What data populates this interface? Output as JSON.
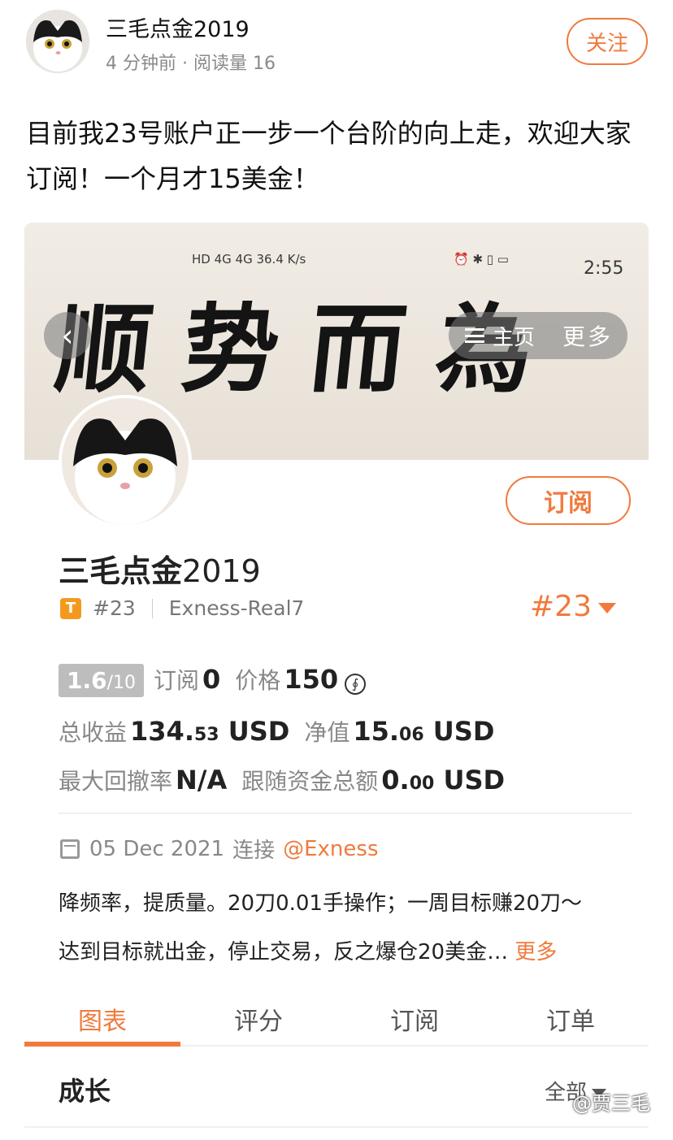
{
  "post": {
    "author": "三毛点金2019",
    "meta": "4 分钟前 · 阅读量 16",
    "follow_label": "关注",
    "text": "目前我23号账户正一步一个台阶的向上走，欢迎大家订阅！一个月才15美金！"
  },
  "screenshot": {
    "status_left": "HD 4G 4G 36.4 K/s",
    "status_time": "2:55",
    "banner_text": "顺势而為",
    "back_icon": "chevron-left-icon",
    "home_label": "主页",
    "more_label": "更多",
    "subscribe_label": "订阅",
    "profile": {
      "name_main": "三毛点金",
      "name_year": "2019",
      "tier_badge": "T",
      "rank": "#23",
      "broker": "Exness-Real7",
      "rank_right": "#23"
    },
    "stats": {
      "score": "1.6",
      "score_denom": "/10",
      "subs_label": "订阅",
      "subs_value": "0",
      "price_label": "价格",
      "price_value": "150",
      "coin_symbol": "∮",
      "total_label": "总收益",
      "total_int": "134.",
      "total_dec": "53",
      "total_unit": "USD",
      "equity_label": "净值",
      "equity_int": "15.",
      "equity_dec": "06",
      "equity_unit": "USD",
      "drawdown_label": "最大回撤率",
      "drawdown_value": "N/A",
      "follow_label": "跟随资金总额",
      "follow_int": "0.",
      "follow_dec": "00",
      "follow_unit": "USD"
    },
    "date_row": {
      "date": "05 Dec 2021",
      "connect": "连接",
      "broker_link": "@Exness"
    },
    "description_line1": "降频率，提质量。20刀0.01手操作；一周目标赚20刀～",
    "description_line2": "达到目标就出金，停止交易，反之爆仓20美金…",
    "tabs": [
      "图表",
      "评分",
      "订阅",
      "订单"
    ],
    "section_title": "成长",
    "filter_label": "全部"
  },
  "watermark": "@贾三毛",
  "colors": {
    "accent": "#f07a3d",
    "tier_badge": "#f39a1e"
  }
}
